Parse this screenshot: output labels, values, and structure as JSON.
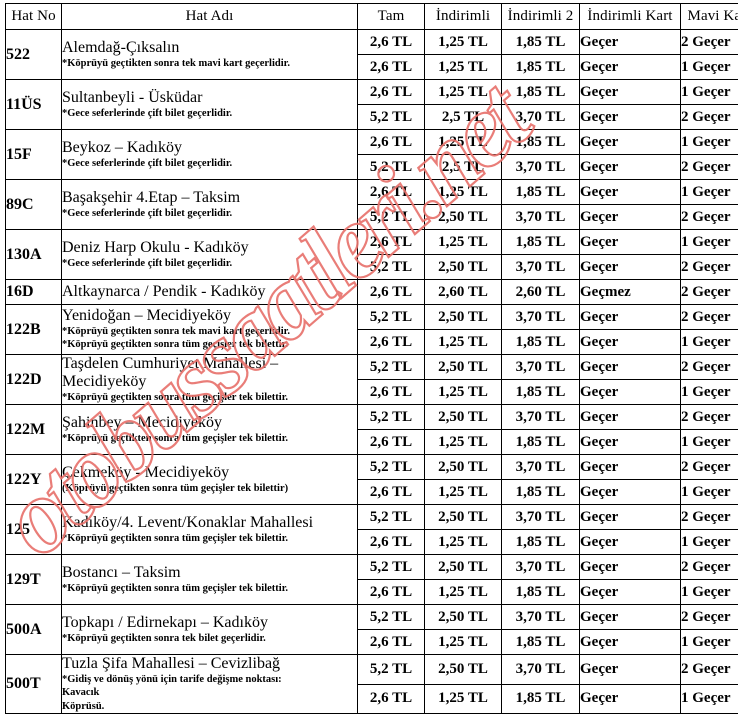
{
  "watermark": {
    "text": "otobussaatleri.net",
    "color": "#e8736d"
  },
  "table": {
    "headers": {
      "hat_no": "Hat No",
      "hat_adi": "Hat Adı",
      "tam": "Tam",
      "indirimli": "İndirimli",
      "indirimli2": "İndirimli 2",
      "indirimli_kart": "İndirimli Kart",
      "mavi_kart": "Mavi Kart"
    },
    "rows": [
      {
        "no": "522",
        "name": "Alemdağ-Çıksalın",
        "notes": [
          "*Köprüyü geçtikten sonra tek mavi kart geçerlidir."
        ],
        "fares": [
          {
            "tam": "2,6 TL",
            "indirimli": "1,25 TL",
            "indirimli2": "1,85 TL",
            "kart": "Geçer",
            "mavi": "2 Geçer"
          },
          {
            "tam": "2,6 TL",
            "indirimli": "1,25 TL",
            "indirimli2": "1,85 TL",
            "kart": "Geçer",
            "mavi": "1 Geçer"
          }
        ]
      },
      {
        "no": "11ÜS",
        "name": "Sultanbeyli - Üsküdar",
        "notes": [
          "*Gece seferlerinde çift bilet geçerlidir."
        ],
        "fares": [
          {
            "tam": "2,6 TL",
            "indirimli": "1,25 TL",
            "indirimli2": "1,85 TL",
            "kart": "Geçer",
            "mavi": "1 Geçer"
          },
          {
            "tam": "5,2 TL",
            "indirimli": "2,5 TL",
            "indirimli2": "3,70 TL",
            "kart": "Geçer",
            "mavi": "2 Geçer"
          }
        ]
      },
      {
        "no": "15F",
        "name": "Beykoz – Kadıköy",
        "notes": [
          "*Gece seferlerinde çift bilet geçerlidir."
        ],
        "fares": [
          {
            "tam": "2,6 TL",
            "indirimli": "1,25 TL",
            "indirimli2": "1,85 TL",
            "kart": "Geçer",
            "mavi": "1 Geçer"
          },
          {
            "tam": "5,2 TL",
            "indirimli": "2,5 TL",
            "indirimli2": "3,70 TL",
            "kart": "Geçer",
            "mavi": "2 Geçer"
          }
        ]
      },
      {
        "no": "89C",
        "name": "Başakşehir 4.Etap – Taksim",
        "notes": [
          "*Gece seferlerinde çift bilet geçerlidir."
        ],
        "fares": [
          {
            "tam": "2,6 TL",
            "indirimli": "1,25 TL",
            "indirimli2": "1,85 TL",
            "kart": "Geçer",
            "mavi": "1 Geçer"
          },
          {
            "tam": "5,2 TL",
            "indirimli": "2,50 TL",
            "indirimli2": "3,70 TL",
            "kart": "Geçer",
            "mavi": "2 Geçer"
          }
        ]
      },
      {
        "no": "130A",
        "name": "Deniz Harp Okulu - Kadıköy",
        "notes": [
          "*Gece seferlerinde çift bilet geçerlidir."
        ],
        "fares": [
          {
            "tam": "2,6 TL",
            "indirimli": "1,25 TL",
            "indirimli2": "1,85 TL",
            "kart": "Geçer",
            "mavi": "1 Geçer"
          },
          {
            "tam": "5,2 TL",
            "indirimli": "2,50 TL",
            "indirimli2": "3,70 TL",
            "kart": "Geçer",
            "mavi": "2 Geçer"
          }
        ]
      },
      {
        "no": "16D",
        "name": "Altkaynarca / Pendik - Kadıköy",
        "notes": [],
        "fares": [
          {
            "tam": "2,6 TL",
            "indirimli": "2,60 TL",
            "indirimli2": "2,60 TL",
            "kart": "Geçmez",
            "mavi": "2 Geçer"
          }
        ]
      },
      {
        "no": "122B",
        "name": "Yenidoğan – Mecidiyeköy",
        "notes": [
          "*Köprüyü geçtikten sonra tek mavi kart geçerlidir.",
          "*Köprüyü geçtikten sonra tüm geçişler tek bilettir."
        ],
        "fares": [
          {
            "tam": "5,2 TL",
            "indirimli": "2,50 TL",
            "indirimli2": "3,70 TL",
            "kart": "Geçer",
            "mavi": "2 Geçer"
          },
          {
            "tam": "2,6 TL",
            "indirimli": "1,25 TL",
            "indirimli2": "1,85 TL",
            "kart": "Geçer",
            "mavi": "1 Geçer"
          }
        ]
      },
      {
        "no": "122D",
        "name": "Taşdelen Cumhuriyet Mahallesi – Mecidiyeköy",
        "notes": [
          "*Köprüyü geçtikten sonra tüm geçişler tek bilettir."
        ],
        "fares": [
          {
            "tam": "5,2 TL",
            "indirimli": "2,50 TL",
            "indirimli2": "3,70 TL",
            "kart": "Geçer",
            "mavi": "2 Geçer"
          },
          {
            "tam": "2,6 TL",
            "indirimli": "1,25 TL",
            "indirimli2": "1,85 TL",
            "kart": "Geçer",
            "mavi": "1 Geçer"
          }
        ]
      },
      {
        "no": "122M",
        "name": "Şahinbey – Mecidiyeköy",
        "notes": [
          "*Köprüyü geçtikten sonra tüm geçişler tek bilettir."
        ],
        "fares": [
          {
            "tam": "5,2 TL",
            "indirimli": "2,50 TL",
            "indirimli2": "3,70 TL",
            "kart": "Geçer",
            "mavi": "2 Geçer"
          },
          {
            "tam": "2,6 TL",
            "indirimli": "1,25 TL",
            "indirimli2": "1,85 TL",
            "kart": "Geçer",
            "mavi": "1 Geçer"
          }
        ]
      },
      {
        "no": "122Y",
        "name": "Çekmeköy - Mecidiyeköy",
        "notes": [
          "(Köprüyü geçtikten sonra tüm geçişler tek bilettir)"
        ],
        "fares": [
          {
            "tam": "5,2 TL",
            "indirimli": "2,50 TL",
            "indirimli2": "3,70 TL",
            "kart": "Geçer",
            "mavi": "2 Geçer"
          },
          {
            "tam": "2,6 TL",
            "indirimli": "1,25 TL",
            "indirimli2": "1,85 TL",
            "kart": "Geçer",
            "mavi": "1 Geçer"
          }
        ]
      },
      {
        "no": "125",
        "name": "Kadıköy/4. Levent/Konaklar Mahallesi",
        "notes": [
          "*Köprüyü geçtikten sonra tüm geçişler tek bilettir."
        ],
        "fares": [
          {
            "tam": "5,2 TL",
            "indirimli": "2,50 TL",
            "indirimli2": "3,70 TL",
            "kart": "Geçer",
            "mavi": "2 Geçer"
          },
          {
            "tam": "2,6 TL",
            "indirimli": "1,25 TL",
            "indirimli2": "1,85 TL",
            "kart": "Geçer",
            "mavi": "1 Geçer"
          }
        ]
      },
      {
        "no": "129T",
        "name": "Bostancı – Taksim",
        "notes": [
          "*Köprüyü geçtikten sonra tüm geçişler tek bilettir."
        ],
        "fares": [
          {
            "tam": "5,2 TL",
            "indirimli": "2,50 TL",
            "indirimli2": "3,70 TL",
            "kart": "Geçer",
            "mavi": "2 Geçer"
          },
          {
            "tam": "2,6 TL",
            "indirimli": "1,25 TL",
            "indirimli2": "1,85 TL",
            "kart": "Geçer",
            "mavi": "1 Geçer"
          }
        ]
      },
      {
        "no": "500A",
        "name": "Topkapı / Edirnekapı – Kadıköy",
        "notes": [
          "*Köprüyü geçtikten sonra tek bilet geçerlidir."
        ],
        "fares": [
          {
            "tam": "5,2 TL",
            "indirimli": "2,50 TL",
            "indirimli2": "3,70 TL",
            "kart": "Geçer",
            "mavi": "2 Geçer"
          },
          {
            "tam": "2,6 TL",
            "indirimli": "1,25 TL",
            "indirimli2": "1,85 TL",
            "kart": "Geçer",
            "mavi": "1 Geçer"
          }
        ]
      },
      {
        "no": "500T",
        "name": "Tuzla Şifa Mahallesi – Cevizlibağ",
        "notes": [
          "*Gidiş ve dönüş yönü için tarife değişme noktası:",
          "Kavacık",
          "Köprüsü."
        ],
        "fares": [
          {
            "tam": "5,2 TL",
            "indirimli": "2,50 TL",
            "indirimli2": "3,70 TL",
            "kart": "Geçer",
            "mavi": "2 Geçer"
          },
          {
            "tam": "2,6 TL",
            "indirimli": "1,25 TL",
            "indirimli2": "1,85 TL",
            "kart": "Geçer",
            "mavi": "1 Geçer"
          }
        ]
      }
    ]
  }
}
